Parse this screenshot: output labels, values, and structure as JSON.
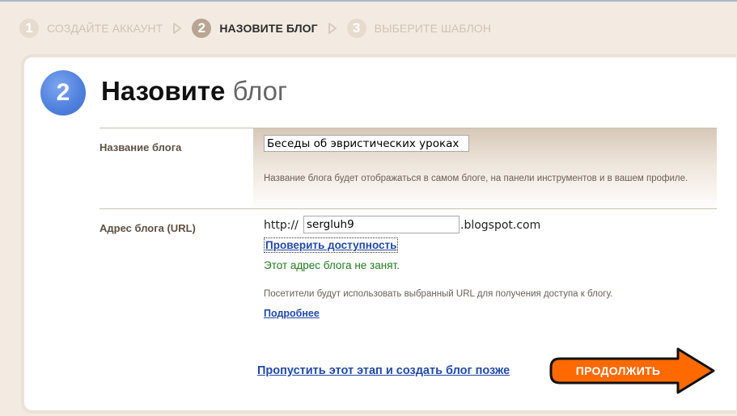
{
  "steps": [
    {
      "num": "1",
      "label": "СОЗДАЙТЕ АККАУНТ"
    },
    {
      "num": "2",
      "label": "НАЗОВИТЕ БЛОГ"
    },
    {
      "num": "3",
      "label": "ВЫБЕРИТЕ ШАБЛОН"
    }
  ],
  "main": {
    "step_number": "2",
    "title_bold": "Назовите",
    "title_rest": "блог"
  },
  "blog_name": {
    "label": "Название блога",
    "value": "Беседы об эвристических уроках",
    "help": "Название блога будет отображаться в самом блоге, на панели инструментов и в вашем профиле."
  },
  "blog_url": {
    "label": "Адрес блога (URL)",
    "prefix": "http://",
    "value": "sergluh9",
    "suffix": ".blogspot.com",
    "check_link": "Проверить доступность",
    "available_msg": "Этот адрес блога не занят.",
    "help": "Посетители будут использовать выбранный URL для получения доступа к блогу.",
    "more_link": "Подробнее"
  },
  "actions": {
    "skip_link": "Пропустить этот этап и создать блог позже",
    "continue_label": "ПРОДОЛЖИТЬ"
  },
  "colors": {
    "accent_orange": "#ff6600",
    "link_blue": "#2149a8",
    "success_green": "#1e7b1e",
    "step_blue": "#4f7fdc"
  }
}
